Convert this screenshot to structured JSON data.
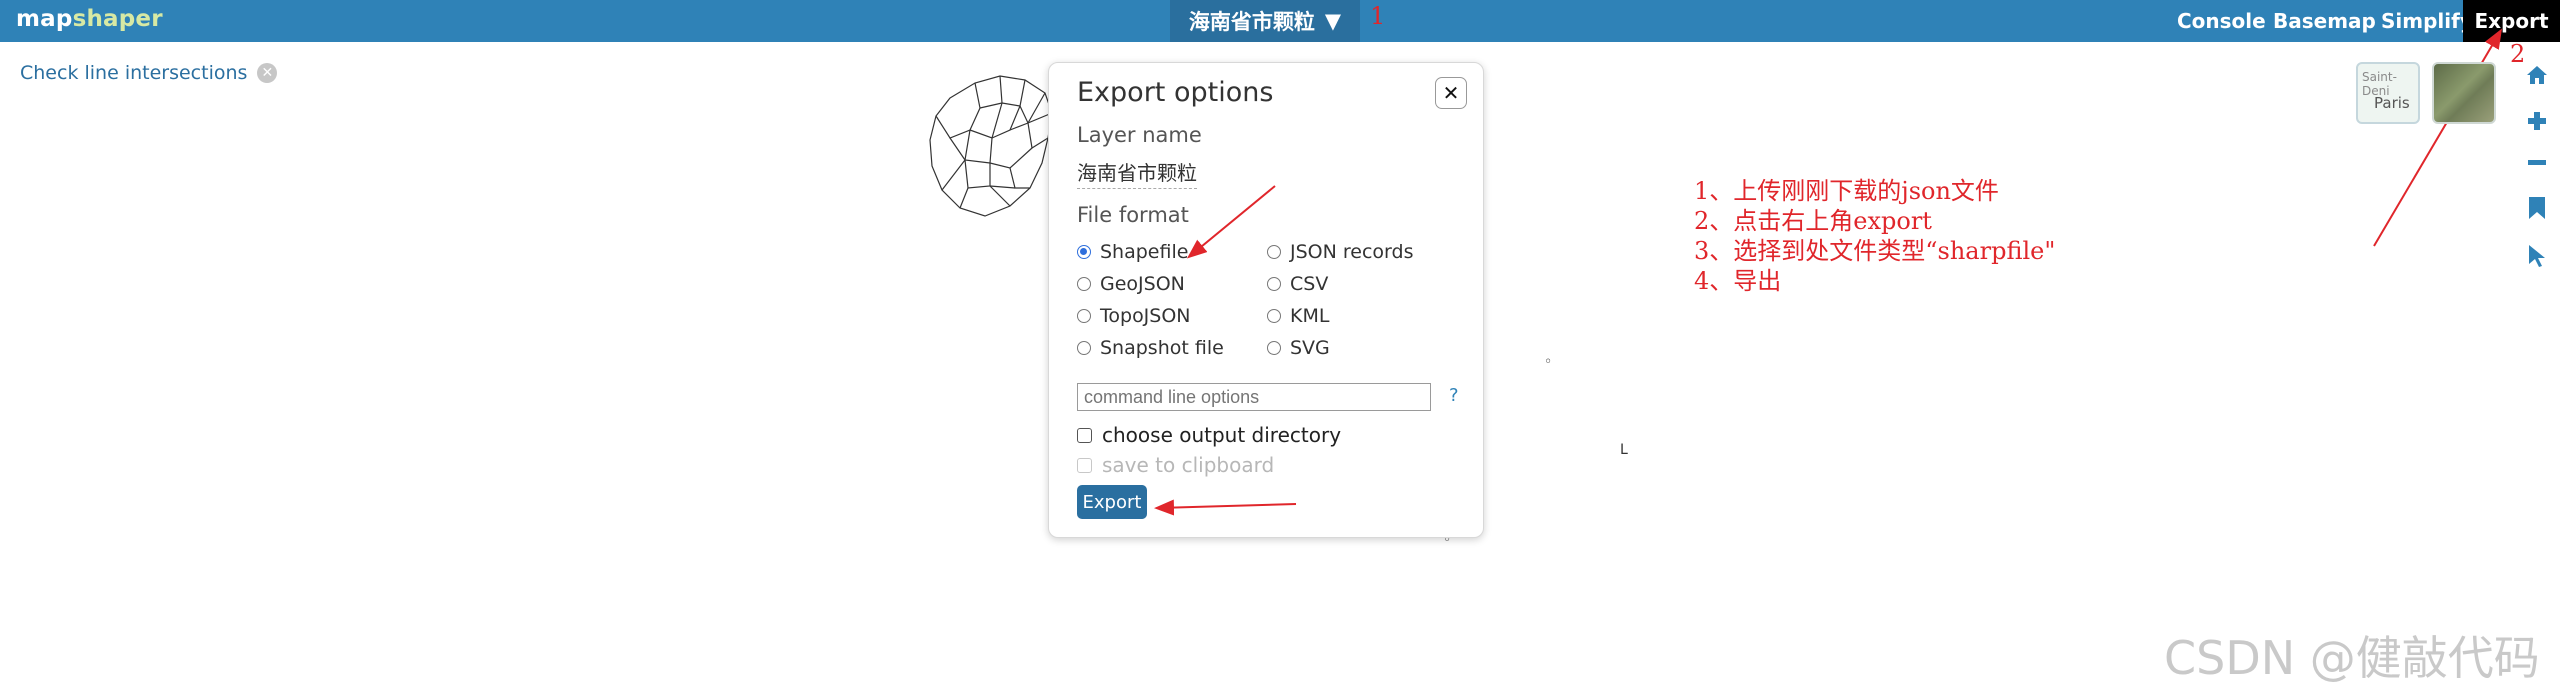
{
  "app": {
    "logo_part1": "map",
    "logo_part2": "shaper"
  },
  "topbar": {
    "layer_menu_label": "海南省市颗粒",
    "layer_menu_caret": "▼",
    "buttons": {
      "console": "Console",
      "basemap": "Basemap",
      "simplify": "Simplify",
      "export": "Export"
    }
  },
  "intersections": {
    "label": "Check line intersections",
    "close_glyph": "✕"
  },
  "dialog": {
    "title": "Export options",
    "close_glyph": "✕",
    "layer_name_label": "Layer name",
    "layer_name_value": "海南省市颗粒",
    "file_format_label": "File format",
    "formats": [
      {
        "label": "Shapefile",
        "selected": true
      },
      {
        "label": "JSON records",
        "selected": false
      },
      {
        "label": "GeoJSON",
        "selected": false
      },
      {
        "label": "CSV",
        "selected": false
      },
      {
        "label": "TopoJSON",
        "selected": false
      },
      {
        "label": "KML",
        "selected": false
      },
      {
        "label": "Snapshot file",
        "selected": false
      },
      {
        "label": "SVG",
        "selected": false
      }
    ],
    "command_placeholder": "command line options",
    "help_glyph": "?",
    "choose_dir_label": "choose output directory",
    "clipboard_label": "save to clipboard",
    "export_button": "Export"
  },
  "annotations": {
    "num1": "1",
    "num2": "2",
    "num3": "3",
    "num4": "4",
    "color": "#e0262b",
    "steps": [
      "1、上传刚刚下载的json文件",
      "2、点击右上角export",
      "3、选择到处文件类型“sharpfile\"",
      "4、导出"
    ]
  },
  "basemap_thumbs": {
    "street_label_1": "Saint-Deni",
    "street_label_2": "Paris"
  },
  "watermark": "CSDN @健敲代码",
  "colors": {
    "topbar": "#2f82b7",
    "layer_button": "#2a6f9e",
    "accent": "#2a6fa0"
  }
}
